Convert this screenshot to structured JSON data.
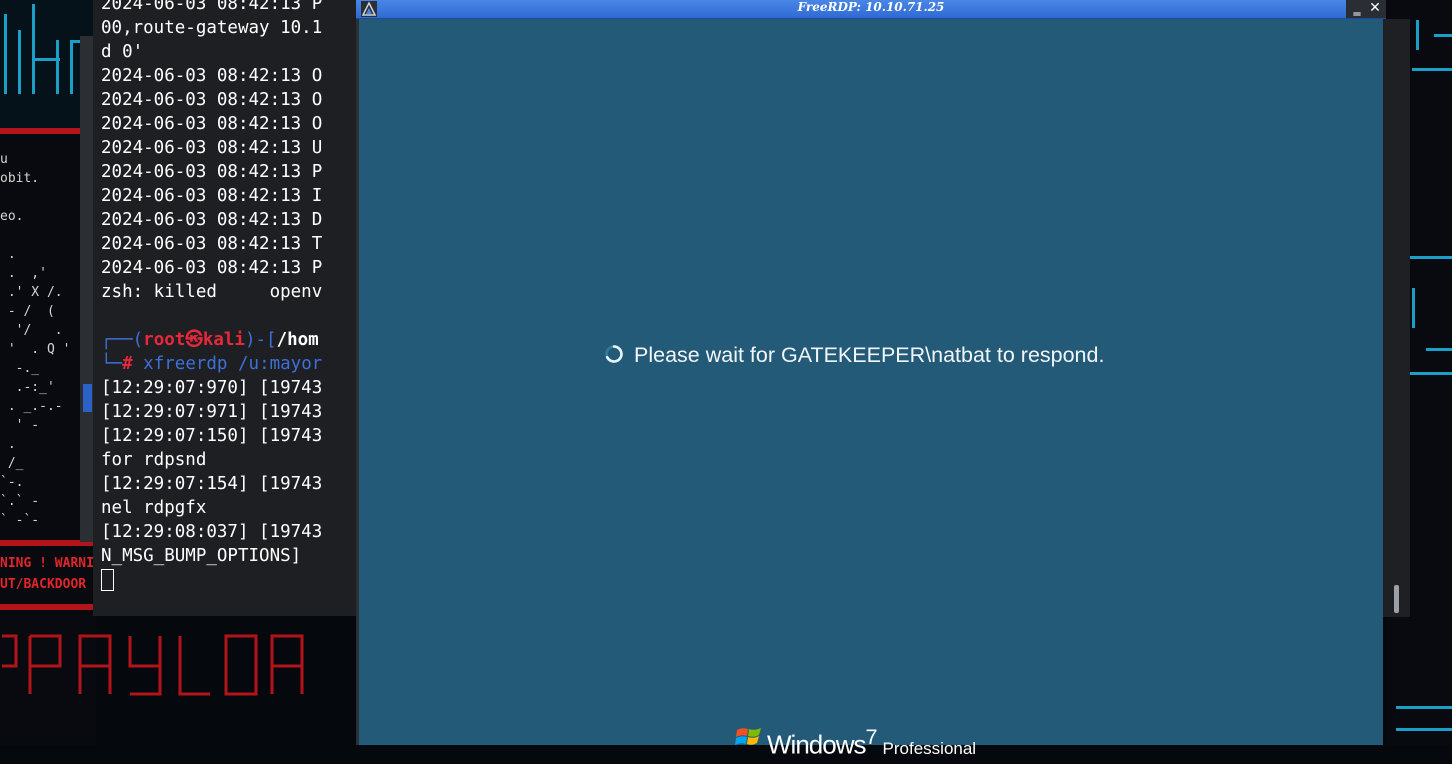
{
  "rdp_window": {
    "title": "FreeRDP: 10.10.71.25",
    "status_message": "Please wait for GATEKEEPER\\natbat to respond.",
    "brand_name": "Windows",
    "brand_version": "7",
    "brand_edition": "Professional",
    "minimize_label": "‗",
    "close_label": "✕"
  },
  "terminal": {
    "lines": [
      "2024-06-03 08:42:13 P",
      "00,route-gateway 10.1",
      "d 0'",
      "2024-06-03 08:42:13 O",
      "2024-06-03 08:42:13 O",
      "2024-06-03 08:42:13 O",
      "2024-06-03 08:42:13 U",
      "2024-06-03 08:42:13 P",
      "2024-06-03 08:42:13 I",
      "2024-06-03 08:42:13 D",
      "2024-06-03 08:42:13 T",
      "2024-06-03 08:42:13 P",
      "zsh: killed     openv"
    ],
    "prompt_top_prefix": "┌──(",
    "prompt_user": "root",
    "prompt_at": "㉿",
    "prompt_host": "kali",
    "prompt_sep": ")-[",
    "prompt_path": "/hom",
    "prompt_bottom_prefix": "└─",
    "prompt_hash": "#",
    "command": "xfreerdp /u:mayor",
    "output_lines": [
      "[12:29:07:970] [19743",
      "[12:29:07:971] [19743",
      "[12:29:07:150] [19743",
      "for rdpsnd",
      "[12:29:07:154] [19743",
      "nel rdpgfx",
      "[12:29:08:037] [19743",
      "N_MSG_BUMP_OPTIONS]"
    ]
  },
  "background": {
    "warning_line_1": "NING ! WARNIN",
    "warning_line_2": "UT/BACKDOOR !",
    "ascii_art": "u\nobit.\n\neo.\n\n .\n .  ,'\n .' X /.\n - /  (\n  '/   .\n '  . Q '\n  -._\n  .-:_'\n . _.-.-\n  ' -\n .\n /_\n`-.\n`.` -\n` -`-"
  },
  "colors": {
    "rdp_background": "#235a77",
    "terminal_background": "#1d1f23",
    "title_bar": "#2f6ad4",
    "accent_red": "#b3141a",
    "accent_teal": "#1aa0c8"
  }
}
